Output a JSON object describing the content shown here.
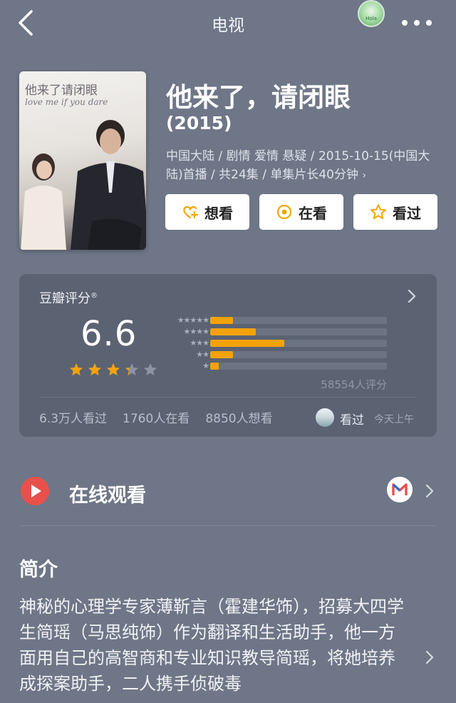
{
  "header": {
    "title": "电视",
    "back_icon": "chevron-left-icon",
    "more_icon": "more-horizontal-icon"
  },
  "mini_app": {
    "label": "Hola"
  },
  "poster": {
    "title_cn": "他来了请闭眼",
    "title_en": "love me if you dare"
  },
  "show": {
    "title": "他来了，请闭眼",
    "year": "(2015)",
    "meta": "中国大陆 / 剧情 爱情 悬疑 / 2015-10-15(中国大陆)首播 / 共24集 / 单集片长40分钟",
    "meta_chevron": "›"
  },
  "actions": [
    {
      "label": "想看",
      "icon": "heart-plus-icon"
    },
    {
      "label": "在看",
      "icon": "target-circle-icon"
    },
    {
      "label": "看过",
      "icon": "star-outline-icon"
    }
  ],
  "rating": {
    "label": "豆瓣评分",
    "reg_mark": "®",
    "score": "6.6",
    "stars_value": 3.3,
    "distribution": [
      {
        "stars": "★★★★★",
        "fraction": 0.13
      },
      {
        "stars": "★★★★",
        "fraction": 0.26
      },
      {
        "stars": "★★★",
        "fraction": 0.42
      },
      {
        "stars": "★★",
        "fraction": 0.13
      },
      {
        "stars": "★",
        "fraction": 0.05
      }
    ],
    "count": "58554人评分",
    "watched": "6.3万人看过",
    "watching": "1760人在看",
    "want": "8850人想看",
    "user_status": "看过",
    "user_time": "今天上午",
    "accent": "#f5a20a"
  },
  "online": {
    "label": "在线观看"
  },
  "intro": {
    "title": "简介",
    "text": "神秘的心理学专家薄靳言（霍建华饰），招募大四学生简瑶（马思纯饰）作为翻译和生活助手，他一方面用自己的高智商和专业知识教导简瑶，将她培养成探案助手，二人携手侦破毒"
  }
}
